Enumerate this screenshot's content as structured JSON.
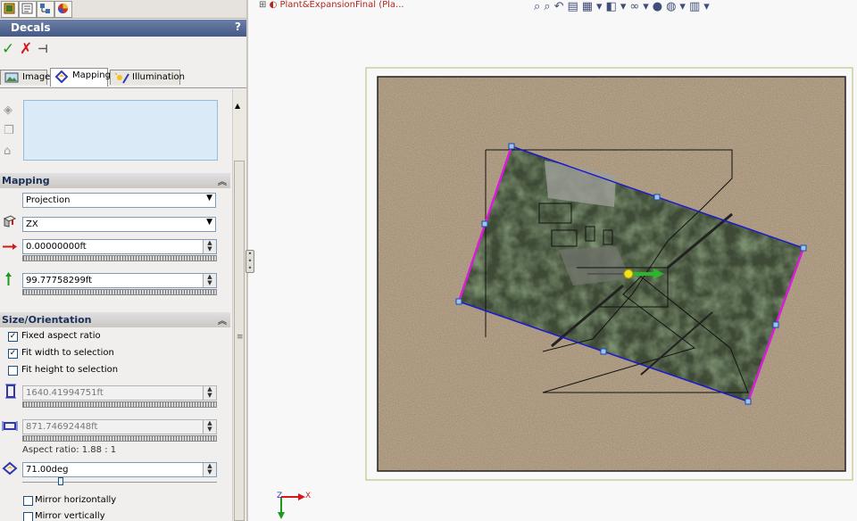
{
  "panel": {
    "title": "Decals",
    "help": "?",
    "tabs": {
      "image": "Image",
      "mapping": "Mapping",
      "illumination": "Illumination"
    },
    "mapping_section": {
      "title": "Mapping",
      "mapping_type": "Projection",
      "projection_direction": "ZX",
      "horizontal_location": "0.00000000ft",
      "vertical_location": "99.77758299ft"
    },
    "size_section": {
      "title": "Size/Orientation",
      "fixed_aspect_ratio": {
        "label": "Fixed aspect ratio",
        "checked": true
      },
      "fit_width": {
        "label": "Fit width to selection",
        "checked": true
      },
      "fit_height": {
        "label": "Fit height to selection",
        "checked": false
      },
      "width": "1640.41994751ft",
      "height": "871.74692448ft",
      "aspect_ratio": "Aspect ratio: 1.88 : 1",
      "rotation": "71.00deg",
      "rotation_fraction": 0.19,
      "mirror_horizontal": {
        "label": "Mirror horizontally",
        "checked": false
      },
      "mirror_vertical": {
        "label": "Mirror vertically",
        "checked": false
      }
    }
  },
  "viewport": {
    "document_title": "Plant&ExpansionFinal  (Pla...",
    "triad": {
      "x": "X",
      "z": "Z"
    }
  },
  "colors": {
    "decal_outline": "#1a1acc",
    "edge_highlight": "#d81cd8",
    "title_red": "#b3261e"
  }
}
